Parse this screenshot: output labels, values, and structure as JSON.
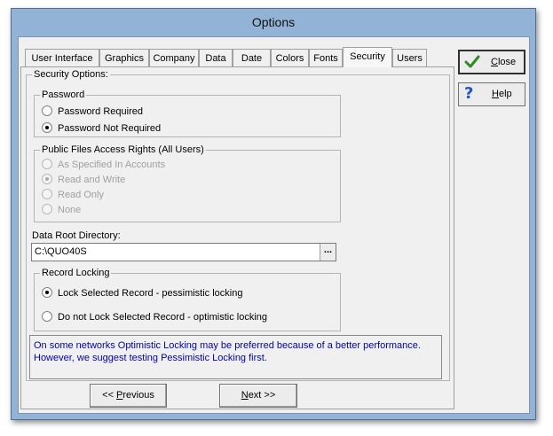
{
  "window": {
    "title": "Options"
  },
  "tabs": [
    {
      "label": "User Interface"
    },
    {
      "label": "Graphics"
    },
    {
      "label": "Company"
    },
    {
      "label": "Data"
    },
    {
      "label": "Date"
    },
    {
      "label": "Colors"
    },
    {
      "label": "Fonts"
    },
    {
      "label": "Security",
      "active": true
    },
    {
      "label": "Users"
    }
  ],
  "security": {
    "section_label": "Security Options:",
    "password": {
      "label": "Password",
      "options": [
        {
          "label": "Password Required",
          "checked": false
        },
        {
          "label": "Password Not Required",
          "checked": true
        }
      ]
    },
    "public_files": {
      "label": "Public Files Access Rights (All Users)",
      "options": [
        {
          "label": "As Specified In Accounts",
          "checked": false,
          "disabled": true
        },
        {
          "label": "Read and Write",
          "checked": true,
          "disabled": true
        },
        {
          "label": "Read Only",
          "checked": false,
          "disabled": true
        },
        {
          "label": "None",
          "checked": false,
          "disabled": true
        }
      ]
    },
    "data_root": {
      "label": "Data Root Directory:",
      "value": "C:\\QUO40S",
      "browse_label": "..."
    },
    "record_locking": {
      "label": "Record Locking",
      "options": [
        {
          "label": "Lock Selected Record - pessimistic locking",
          "checked": true
        },
        {
          "label": "Do not Lock Selected Record - optimistic locking",
          "checked": false
        }
      ]
    },
    "info_lines": [
      "On some networks Optimistic Locking may be preferred because of a better performance.",
      "However, we suggest testing Pessimistic Locking first."
    ]
  },
  "buttons": {
    "close": {
      "accel": "C",
      "rest": "lose"
    },
    "help": {
      "accel": "H",
      "rest": "elp"
    },
    "previous": {
      "prefix": "<< ",
      "accel": "P",
      "rest": "revious"
    },
    "next": {
      "accel": "N",
      "rest": "ext >>"
    }
  },
  "colors": {
    "frame": "#92b2d6",
    "info_text": "#0000c0",
    "check_green": "#2e8b20",
    "help_blue": "#1f55c8"
  },
  "icons": {
    "close": "check-icon",
    "help": "question-mark-icon"
  }
}
